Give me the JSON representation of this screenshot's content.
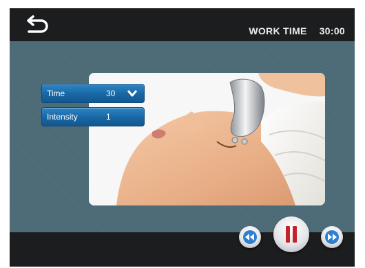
{
  "header": {
    "back_icon": "back-arrow-icon",
    "work_time_label": "WORK TIME",
    "work_time_value": "30:00"
  },
  "params": {
    "time": {
      "label": "Time",
      "value": "30",
      "icon": "chevron-down-icon"
    },
    "intensity": {
      "label": "Intensity",
      "value": "1"
    }
  },
  "controls": {
    "rewind_icon": "rewind-icon",
    "pause_icon": "pause-icon",
    "forward_icon": "fast-forward-icon"
  },
  "colors": {
    "panel_bg": "#4d6b78",
    "bar_bg": "#1c1d1f",
    "button_blue": "#1866a4",
    "pause_red": "#c4232b",
    "control_blue": "#2e7fd0"
  }
}
